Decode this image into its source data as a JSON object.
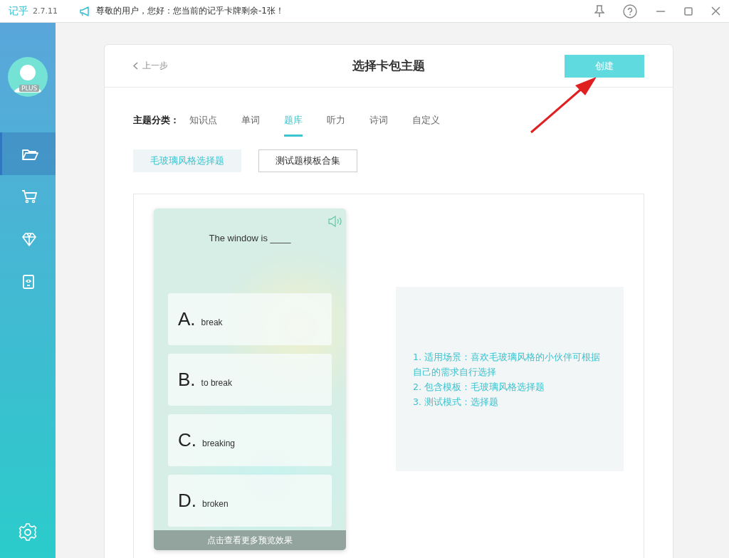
{
  "titlebar": {
    "app_name": "记乎",
    "version": "2.7.11",
    "notice": "尊敬的用户，您好：您当前的记乎卡牌剩余-1张！"
  },
  "sidebar": {
    "badge": "PLUS",
    "items": [
      {
        "selected": true
      },
      {
        "selected": false
      },
      {
        "selected": false
      },
      {
        "selected": false
      }
    ]
  },
  "header": {
    "back": "上一步",
    "title": "选择卡包主题",
    "create_button": "创建"
  },
  "category": {
    "label": "主题分类：",
    "tabs": [
      {
        "label": "知识点",
        "selected": false
      },
      {
        "label": "单词",
        "selected": false
      },
      {
        "label": "题库",
        "selected": true
      },
      {
        "label": "听力",
        "selected": false
      },
      {
        "label": "诗词",
        "selected": false
      },
      {
        "label": "自定义",
        "selected": false
      }
    ]
  },
  "templates": [
    {
      "label": "毛玻璃风格选择题",
      "selected": true
    },
    {
      "label": "测试题模板合集",
      "selected": false
    }
  ],
  "preview": {
    "question": "The window is ____",
    "options": [
      {
        "letter": "A.",
        "text": "break"
      },
      {
        "letter": "B.",
        "text": "to break"
      },
      {
        "letter": "C.",
        "text": "breaking"
      },
      {
        "letter": "D.",
        "text": "broken"
      }
    ],
    "more": "点击查看更多预览效果"
  },
  "description": [
    "1. 适用场景：喜欢毛玻璃风格的小伙伴可根据自己的需求自行选择",
    "2. 包含模板：毛玻璃风格选择题",
    "3. 测试模式：选择题"
  ]
}
